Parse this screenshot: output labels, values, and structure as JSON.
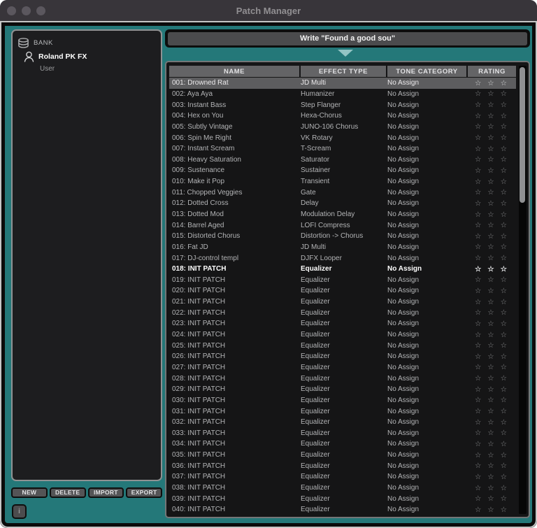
{
  "window": {
    "title": "Patch Manager"
  },
  "sidebar": {
    "bank_label": "BANK",
    "items": [
      {
        "label": "Roland PK FX"
      },
      {
        "label": "User"
      }
    ],
    "buttons": [
      {
        "label": "NEW"
      },
      {
        "label": "DELETE"
      },
      {
        "label": "IMPORT"
      },
      {
        "label": "EXPORT"
      }
    ],
    "info_button_label": "i"
  },
  "main": {
    "write_button_label": "Write \"Found a good sou\"",
    "table": {
      "columns": [
        "NAME",
        "EFFECT TYPE",
        "TONE CATEGORY",
        "RATING"
      ],
      "selected_row_index": 0,
      "bold_row_index": 17,
      "rating_max": 3,
      "star_icon": "☆",
      "rows": [
        {
          "name": "001: Drowned Rat",
          "effect_type": "JD Multi",
          "tone_category": "No Assign",
          "rating": 0
        },
        {
          "name": "002: Aya Aya",
          "effect_type": "Humanizer",
          "tone_category": "No Assign",
          "rating": 0
        },
        {
          "name": "003: Instant Bass",
          "effect_type": "Step Flanger",
          "tone_category": "No Assign",
          "rating": 0
        },
        {
          "name": "004: Hex on You",
          "effect_type": "Hexa-Chorus",
          "tone_category": "No Assign",
          "rating": 0
        },
        {
          "name": "005: Subtly Vintage",
          "effect_type": "JUNO-106 Chorus",
          "tone_category": "No Assign",
          "rating": 0
        },
        {
          "name": "006: Spin Me Right",
          "effect_type": "VK Rotary",
          "tone_category": "No Assign",
          "rating": 0
        },
        {
          "name": "007: Instant Scream",
          "effect_type": "T-Scream",
          "tone_category": "No Assign",
          "rating": 0
        },
        {
          "name": "008: Heavy Saturation",
          "effect_type": "Saturator",
          "tone_category": "No Assign",
          "rating": 0
        },
        {
          "name": "009: Sustenance",
          "effect_type": "Sustainer",
          "tone_category": "No Assign",
          "rating": 0
        },
        {
          "name": "010: Make it Pop",
          "effect_type": "Transient",
          "tone_category": "No Assign",
          "rating": 0
        },
        {
          "name": "011: Chopped Veggies",
          "effect_type": "Gate",
          "tone_category": "No Assign",
          "rating": 0
        },
        {
          "name": "012: Dotted Cross",
          "effect_type": "Delay",
          "tone_category": "No Assign",
          "rating": 0
        },
        {
          "name": "013: Dotted Mod",
          "effect_type": "Modulation Delay",
          "tone_category": "No Assign",
          "rating": 0
        },
        {
          "name": "014: Barrel Aged",
          "effect_type": "LOFI Compress",
          "tone_category": "No Assign",
          "rating": 0
        },
        {
          "name": "015: Distorted Chorus",
          "effect_type": "Distortion -> Chorus",
          "tone_category": "No Assign",
          "rating": 0
        },
        {
          "name": "016: Fat JD",
          "effect_type": "JD Multi",
          "tone_category": "No Assign",
          "rating": 0
        },
        {
          "name": "017: DJ-control templ",
          "effect_type": "DJFX Looper",
          "tone_category": "No Assign",
          "rating": 0
        },
        {
          "name": "018: INIT PATCH",
          "effect_type": "Equalizer",
          "tone_category": "No Assign",
          "rating": 0
        },
        {
          "name": "019: INIT PATCH",
          "effect_type": "Equalizer",
          "tone_category": "No Assign",
          "rating": 0
        },
        {
          "name": "020: INIT PATCH",
          "effect_type": "Equalizer",
          "tone_category": "No Assign",
          "rating": 0
        },
        {
          "name": "021: INIT PATCH",
          "effect_type": "Equalizer",
          "tone_category": "No Assign",
          "rating": 0
        },
        {
          "name": "022: INIT PATCH",
          "effect_type": "Equalizer",
          "tone_category": "No Assign",
          "rating": 0
        },
        {
          "name": "023: INIT PATCH",
          "effect_type": "Equalizer",
          "tone_category": "No Assign",
          "rating": 0
        },
        {
          "name": "024: INIT PATCH",
          "effect_type": "Equalizer",
          "tone_category": "No Assign",
          "rating": 0
        },
        {
          "name": "025: INIT PATCH",
          "effect_type": "Equalizer",
          "tone_category": "No Assign",
          "rating": 0
        },
        {
          "name": "026: INIT PATCH",
          "effect_type": "Equalizer",
          "tone_category": "No Assign",
          "rating": 0
        },
        {
          "name": "027: INIT PATCH",
          "effect_type": "Equalizer",
          "tone_category": "No Assign",
          "rating": 0
        },
        {
          "name": "028: INIT PATCH",
          "effect_type": "Equalizer",
          "tone_category": "No Assign",
          "rating": 0
        },
        {
          "name": "029: INIT PATCH",
          "effect_type": "Equalizer",
          "tone_category": "No Assign",
          "rating": 0
        },
        {
          "name": "030: INIT PATCH",
          "effect_type": "Equalizer",
          "tone_category": "No Assign",
          "rating": 0
        },
        {
          "name": "031: INIT PATCH",
          "effect_type": "Equalizer",
          "tone_category": "No Assign",
          "rating": 0
        },
        {
          "name": "032: INIT PATCH",
          "effect_type": "Equalizer",
          "tone_category": "No Assign",
          "rating": 0
        },
        {
          "name": "033: INIT PATCH",
          "effect_type": "Equalizer",
          "tone_category": "No Assign",
          "rating": 0
        },
        {
          "name": "034: INIT PATCH",
          "effect_type": "Equalizer",
          "tone_category": "No Assign",
          "rating": 0
        },
        {
          "name": "035: INIT PATCH",
          "effect_type": "Equalizer",
          "tone_category": "No Assign",
          "rating": 0
        },
        {
          "name": "036: INIT PATCH",
          "effect_type": "Equalizer",
          "tone_category": "No Assign",
          "rating": 0
        },
        {
          "name": "037: INIT PATCH",
          "effect_type": "Equalizer",
          "tone_category": "No Assign",
          "rating": 0
        },
        {
          "name": "038: INIT PATCH",
          "effect_type": "Equalizer",
          "tone_category": "No Assign",
          "rating": 0
        },
        {
          "name": "039: INIT PATCH",
          "effect_type": "Equalizer",
          "tone_category": "No Assign",
          "rating": 0
        },
        {
          "name": "040: INIT PATCH",
          "effect_type": "Equalizer",
          "tone_category": "No Assign",
          "rating": 0
        }
      ]
    }
  },
  "colors": {
    "titlebar_bg": "#38353a",
    "titlebar_text": "#918f92",
    "traffic_light": "#5b575e",
    "teal_background": "#247879",
    "frame_outer": "#c6c6c6",
    "frame_inner": "#0b0b0b",
    "panel_bg": "#151516",
    "panel_border": "#737677",
    "header_cell_bg": "#646466",
    "row_text": "#b3b4b6",
    "selected_row_bg": "#5d5d5f",
    "button_bg": "#545456",
    "triangle": "#93c4c4",
    "scroll_thumb": "#8f9092"
  }
}
